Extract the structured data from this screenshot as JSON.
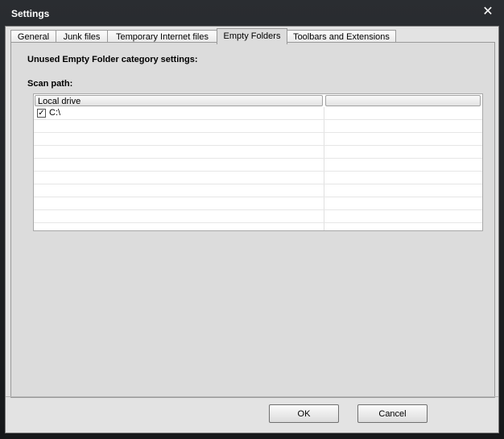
{
  "window": {
    "title": "Settings"
  },
  "tabs": [
    {
      "label": "General"
    },
    {
      "label": "Junk files"
    },
    {
      "label": "Temporary Internet files"
    },
    {
      "label": "Empty Folders"
    },
    {
      "label": "Toolbars and Extensions"
    }
  ],
  "active_tab": "Empty Folders",
  "page": {
    "section_title": "Unused Empty Folder category settings:",
    "scan_label": "Scan path:"
  },
  "list": {
    "columns": [
      "Local drive",
      ""
    ],
    "rows": [
      {
        "checked": true,
        "drive": "C:\\"
      }
    ]
  },
  "buttons": {
    "ok": "OK",
    "cancel": "Cancel"
  }
}
